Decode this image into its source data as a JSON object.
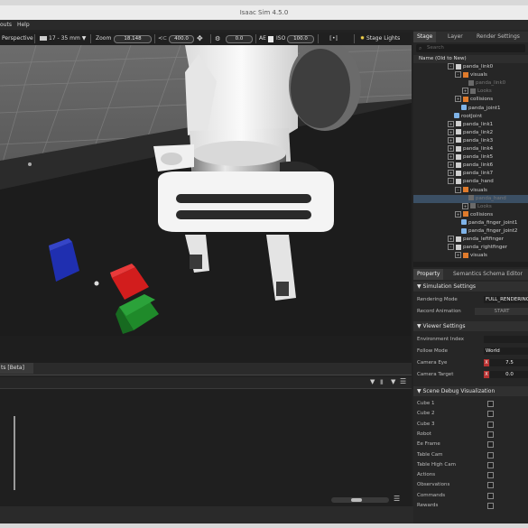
{
  "window": {
    "title": "Isaac Sim 4.5.0"
  },
  "menubar": {
    "items": [
      "outs",
      "Help"
    ]
  },
  "viewport_toolbar": {
    "perspective": "Perspective",
    "lens": "17 - 35 mm",
    "zoom_label": "Zoom",
    "zoom_value": "18.148",
    "speed_value": "400.0",
    "rot_value": "0.0",
    "ae_label": "AE",
    "iso_label": "ISO",
    "iso_value": "100.0",
    "stage_lights": "Stage Lights"
  },
  "console": {
    "tab_label": "ts [Beta]"
  },
  "stage": {
    "tabs": [
      "Stage",
      "Layer",
      "Render Settings"
    ],
    "search_placeholder": "Search",
    "column_header": "Name (Old to New)",
    "tree": [
      {
        "label": "panda_link0",
        "indent": 0,
        "icon": "xform",
        "exp": "-"
      },
      {
        "label": "visuals",
        "indent": 1,
        "icon": "mesh",
        "exp": "-"
      },
      {
        "label": "panda_link0",
        "indent": 2,
        "icon": "mesh-dim",
        "exp": "",
        "dim": true
      },
      {
        "label": "Looks",
        "indent": 2,
        "icon": "folder-dim",
        "exp": "+",
        "dim": true
      },
      {
        "label": "collisions",
        "indent": 1,
        "icon": "mesh",
        "exp": "+"
      },
      {
        "label": "panda_joint1",
        "indent": 1,
        "icon": "joint",
        "exp": ""
      },
      {
        "label": "rootJoint",
        "indent": 0,
        "icon": "joint",
        "exp": ""
      },
      {
        "label": "panda_link1",
        "indent": 0,
        "icon": "xform",
        "exp": "+"
      },
      {
        "label": "panda_link2",
        "indent": 0,
        "icon": "xform",
        "exp": "+"
      },
      {
        "label": "panda_link3",
        "indent": 0,
        "icon": "xform",
        "exp": "+"
      },
      {
        "label": "panda_link4",
        "indent": 0,
        "icon": "xform",
        "exp": "+"
      },
      {
        "label": "panda_link5",
        "indent": 0,
        "icon": "xform",
        "exp": "+"
      },
      {
        "label": "panda_link6",
        "indent": 0,
        "icon": "xform",
        "exp": "+"
      },
      {
        "label": "panda_link7",
        "indent": 0,
        "icon": "xform",
        "exp": "+"
      },
      {
        "label": "panda_hand",
        "indent": 0,
        "icon": "xform",
        "exp": "-"
      },
      {
        "label": "visuals",
        "indent": 1,
        "icon": "mesh",
        "exp": "-"
      },
      {
        "label": "panda_hand",
        "indent": 2,
        "icon": "mesh-dim",
        "exp": "",
        "dim": true,
        "sel": true
      },
      {
        "label": "Looks",
        "indent": 2,
        "icon": "folder-dim",
        "exp": "+",
        "dim": true
      },
      {
        "label": "collisions",
        "indent": 1,
        "icon": "mesh",
        "exp": "+"
      },
      {
        "label": "panda_finger_joint1",
        "indent": 1,
        "icon": "joint",
        "exp": ""
      },
      {
        "label": "panda_finger_joint2",
        "indent": 1,
        "icon": "joint",
        "exp": ""
      },
      {
        "label": "panda_leftfinger",
        "indent": 0,
        "icon": "xform",
        "exp": "+"
      },
      {
        "label": "panda_rightfinger",
        "indent": 0,
        "icon": "xform",
        "exp": "-"
      },
      {
        "label": "visuals",
        "indent": 1,
        "icon": "mesh",
        "exp": "+"
      }
    ]
  },
  "props": {
    "tabs": [
      "Property",
      "Semantics Schema Editor"
    ],
    "simulation": {
      "header": "Simulation Settings",
      "rendering_mode_label": "Rendering Mode",
      "rendering_mode_value": "FULL_RENDERING",
      "record_label": "Record Animation",
      "record_button": "START"
    },
    "viewer": {
      "header": "Viewer Settings",
      "env_index_label": "Environment Index",
      "follow_mode_label": "Follow Mode",
      "follow_mode_value": "World",
      "camera_eye_label": "Camera Eye",
      "camera_eye_x": "X",
      "camera_eye_val": "7.5",
      "camera_target_label": "Camera Target",
      "camera_target_x": "X",
      "camera_target_val": "0.0"
    },
    "debug": {
      "header": "Scene Debug Visualization",
      "items": [
        "Cube 1",
        "Cube 2",
        "Cube 3",
        "Robot",
        "Ee Frame",
        "Table Cam",
        "Table High Cam",
        "Actions",
        "Observations",
        "Commands",
        "Rewards"
      ]
    }
  },
  "colors": {
    "selection": "#3b4f64",
    "cube_blue": "#1f2fb0",
    "cube_red": "#d21d1d",
    "cube_green": "#1f8a2a",
    "axis_x": "#b83232"
  }
}
